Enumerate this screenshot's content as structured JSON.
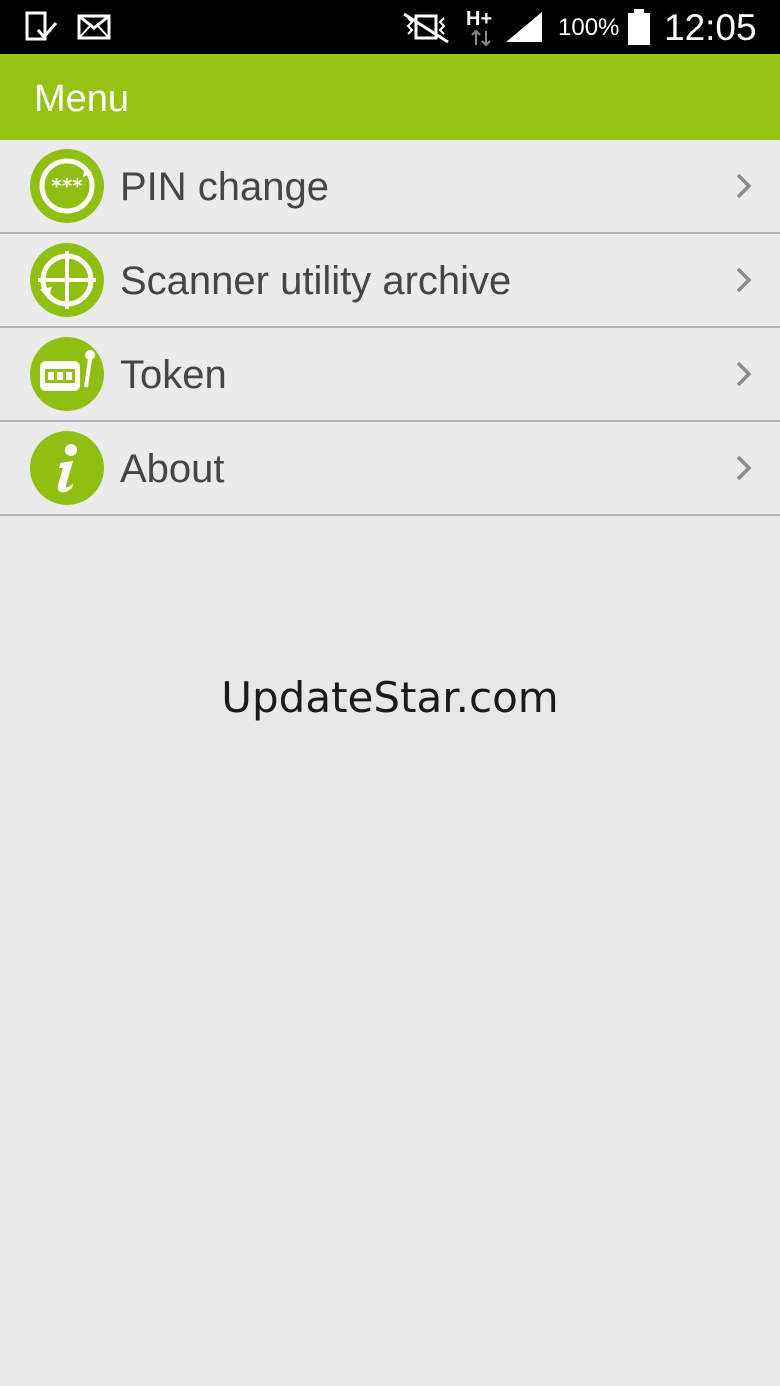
{
  "status_bar": {
    "battery_percent": "100%",
    "time": "12:05",
    "network_type": "H+",
    "icons": [
      "download-done-icon",
      "mail-icon",
      "vibrate-mute-icon",
      "network-h-plus-icon",
      "signal-icon",
      "battery-icon"
    ]
  },
  "action_bar": {
    "title": "Menu"
  },
  "menu": {
    "items": [
      {
        "label": "PIN change",
        "icon": "pin-change-icon"
      },
      {
        "label": "Scanner utility archive",
        "icon": "scanner-target-icon"
      },
      {
        "label": "Token",
        "icon": "token-device-icon"
      },
      {
        "label": "About",
        "icon": "info-icon"
      }
    ]
  },
  "watermark": "UpdateStar.com",
  "colors": {
    "accent": "#96c213",
    "icon_green": "#8fbf12",
    "background": "#e8e8e8",
    "status_bar": "#000000",
    "text": "#454545"
  }
}
